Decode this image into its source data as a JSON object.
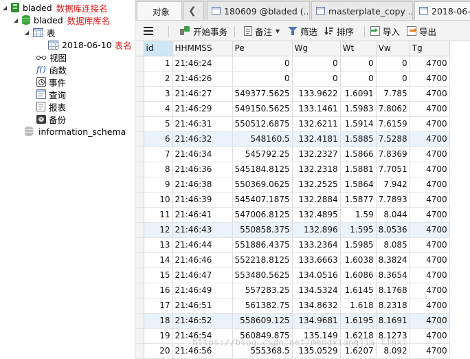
{
  "tree": {
    "connection": {
      "label": "bladed",
      "annotation": "数据库连接名"
    },
    "database": {
      "label": "bladed",
      "annotation": "数据库库名"
    },
    "tables_group": {
      "label": "表"
    },
    "table": {
      "label": "2018-06-10",
      "annotation": "表名"
    },
    "children": [
      {
        "label": "视图",
        "icon": "glasses-icon"
      },
      {
        "label": "函数",
        "icon": "function-icon"
      },
      {
        "label": "事件",
        "icon": "clock-icon"
      },
      {
        "label": "查询",
        "icon": "query-icon"
      },
      {
        "label": "报表",
        "icon": "report-icon"
      },
      {
        "label": "备份",
        "icon": "backup-icon"
      }
    ],
    "other_database": {
      "label": "information_schema"
    }
  },
  "tabs": {
    "objects": "对象",
    "tab1": "180609 @bladed (...",
    "tab2": "masterplate_copy ...",
    "tab3": "2018-06-1"
  },
  "toolbar": {
    "begin_transaction": "开始事务",
    "note": "备注",
    "filter": "筛选",
    "sort": "排序",
    "import": "导入",
    "export": "导出"
  },
  "grid": {
    "columns": [
      "id",
      "HHMMSS",
      "Pe",
      "Wg",
      "Wt",
      "Vw",
      "Tg"
    ],
    "rows": [
      [
        "1",
        "21:46:24",
        "0",
        "0",
        "0",
        "0",
        "4700"
      ],
      [
        "2",
        "21:46:26",
        "0",
        "0",
        "0",
        "0",
        "4700"
      ],
      [
        "3",
        "21:46:27",
        "549377.5625",
        "133.9622",
        "1.6091",
        "7.785",
        "4700"
      ],
      [
        "4",
        "21:46:29",
        "549150.5625",
        "133.1461",
        "1.5983",
        "7.8062",
        "4700"
      ],
      [
        "5",
        "21:46:31",
        "550512.6875",
        "132.6211",
        "1.5914",
        "7.6159",
        "4700"
      ],
      [
        "6",
        "21:46:32",
        "548160.5",
        "132.4181",
        "1.5885",
        "7.5288",
        "4700"
      ],
      [
        "7",
        "21:46:34",
        "545792.25",
        "132.2327",
        "1.5866",
        "7.8369",
        "4700"
      ],
      [
        "8",
        "21:46:36",
        "545184.8125",
        "132.2318",
        "1.5881",
        "7.7051",
        "4700"
      ],
      [
        "9",
        "21:46:38",
        "550369.0625",
        "132.2525",
        "1.5864",
        "7.942",
        "4700"
      ],
      [
        "10",
        "21:46:39",
        "545407.1875",
        "132.2884",
        "1.5877",
        "7.7893",
        "4700"
      ],
      [
        "11",
        "21:46:41",
        "547006.8125",
        "132.4895",
        "1.59",
        "8.044",
        "4700"
      ],
      [
        "12",
        "21:46:43",
        "550858.375",
        "132.896",
        "1.595",
        "8.0536",
        "4700"
      ],
      [
        "13",
        "21:46:44",
        "551886.4375",
        "133.2364",
        "1.5985",
        "8.085",
        "4700"
      ],
      [
        "14",
        "21:46:46",
        "552218.8125",
        "133.6663",
        "1.6038",
        "8.3824",
        "4700"
      ],
      [
        "15",
        "21:46:47",
        "553480.5625",
        "134.0516",
        "1.6086",
        "8.3654",
        "4700"
      ],
      [
        "16",
        "21:46:49",
        "557283.25",
        "134.5324",
        "1.6145",
        "8.1768",
        "4700"
      ],
      [
        "17",
        "21:46:51",
        "561382.75",
        "134.8632",
        "1.618",
        "8.2318",
        "4700"
      ],
      [
        "18",
        "21:46:52",
        "558609.125",
        "134.9681",
        "1.6195",
        "8.1691",
        "4700"
      ],
      [
        "19",
        "21:46:54",
        "560849.875",
        "135.149",
        "1.6218",
        "8.1273",
        "4700"
      ],
      [
        "20",
        "21:46:56",
        "555368.5",
        "135.0529",
        "1.6207",
        "8.092",
        "4700"
      ]
    ]
  },
  "watermark": "https://blog.csdn.net/mengxiangjia_linxi",
  "colors": {
    "annotation_red": "#e0201b",
    "selected_header": "#cfe6f7",
    "database_green": "#3aa33a"
  }
}
